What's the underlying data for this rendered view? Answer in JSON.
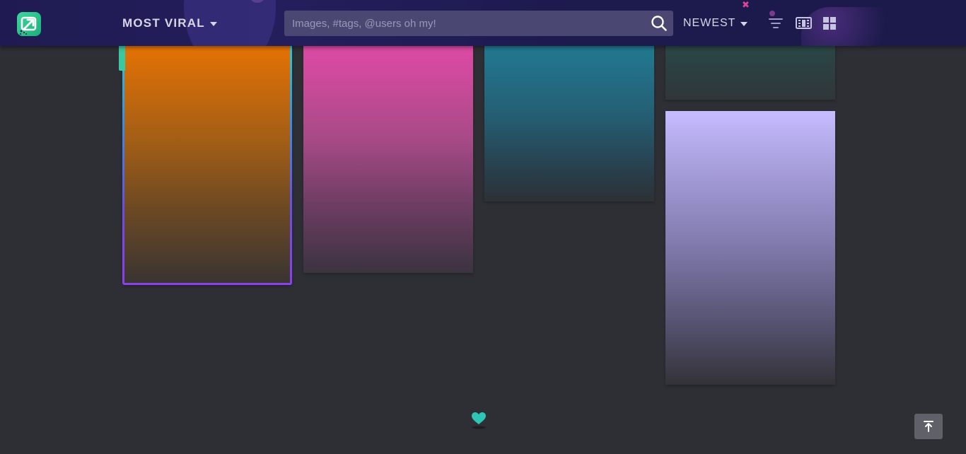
{
  "header": {
    "logo_icon": "imgur-logo-icon",
    "section_label": "MOST VIRAL",
    "search": {
      "placeholder": "Images, #tags, @users oh my!",
      "value": ""
    },
    "sort_label": "NEWEST",
    "icons": [
      "dropdown-caret-icon",
      "search-icon",
      "filter-icon",
      "list-view-icon",
      "grid-view-icon"
    ]
  },
  "gallery": {
    "posts": [
      {
        "index": 1,
        "colors": [
          "#ef7600",
          "#3a3432"
        ],
        "selected": true
      },
      {
        "index": 2,
        "colors": [
          "#e24aa8",
          "#3b3340"
        ]
      },
      {
        "index": 3,
        "colors": [
          "#1e7e94",
          "#2d3136"
        ]
      },
      {
        "index": 4,
        "colors": [
          "#284b4a",
          "#30363a"
        ]
      },
      {
        "index": 5,
        "colors": [
          "#c6bcff",
          "#333238"
        ]
      }
    ]
  },
  "loader_icon": "heart-icon",
  "back_to_top_icon": "arrow-up-to-line-icon",
  "colors": {
    "header_bg": "#1f1b52",
    "page_bg": "#2e2f35",
    "search_bg": "#4a4872",
    "accent_green": "#3ed59d",
    "accent_teal": "#30d5c8",
    "accent_purple": "#8b3ff0"
  }
}
